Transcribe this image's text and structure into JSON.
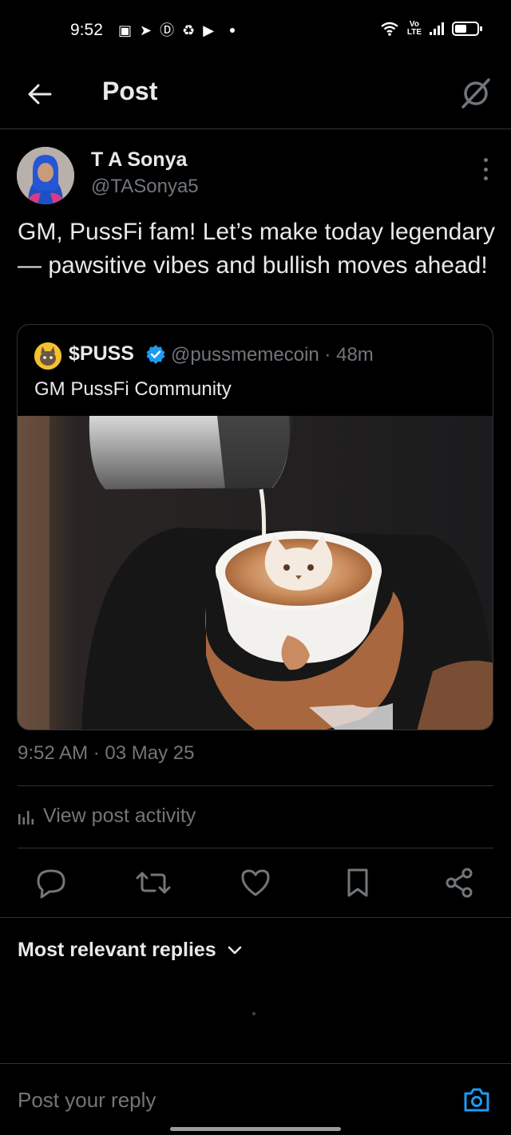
{
  "status_bar": {
    "time": "9:52",
    "lte_label": "LTE",
    "vo_label": "Vo",
    "battery_level": 0.55
  },
  "header": {
    "title": "Post"
  },
  "post": {
    "author_name": "T A Sonya",
    "author_handle": "@TASonya5",
    "text": "GM, PussFi fam! Let’s make today legendary — pawsitive vibes and bullish moves ahead!",
    "timestamp": "9:52 AM · 03 May 25"
  },
  "quote": {
    "name": "$PUSS",
    "handle": "@pussmemecoin · 48m",
    "text": "GM PussFi Community"
  },
  "activity": {
    "label": "View post activity"
  },
  "replies": {
    "sort_label": "Most relevant replies"
  },
  "reply_bar": {
    "placeholder": "Post your reply"
  },
  "colors": {
    "background": "#000000",
    "text_primary": "#e7e9ea",
    "text_secondary": "#71767b",
    "accent": "#1d9bf0",
    "divider": "#2f3336"
  },
  "icons": [
    "back-arrow-icon",
    "grok-icon",
    "more-icon",
    "verified-icon",
    "chart-icon",
    "reply-icon",
    "repost-icon",
    "like-icon",
    "bookmark-icon",
    "share-icon",
    "chevron-down-icon",
    "camera-icon"
  ]
}
